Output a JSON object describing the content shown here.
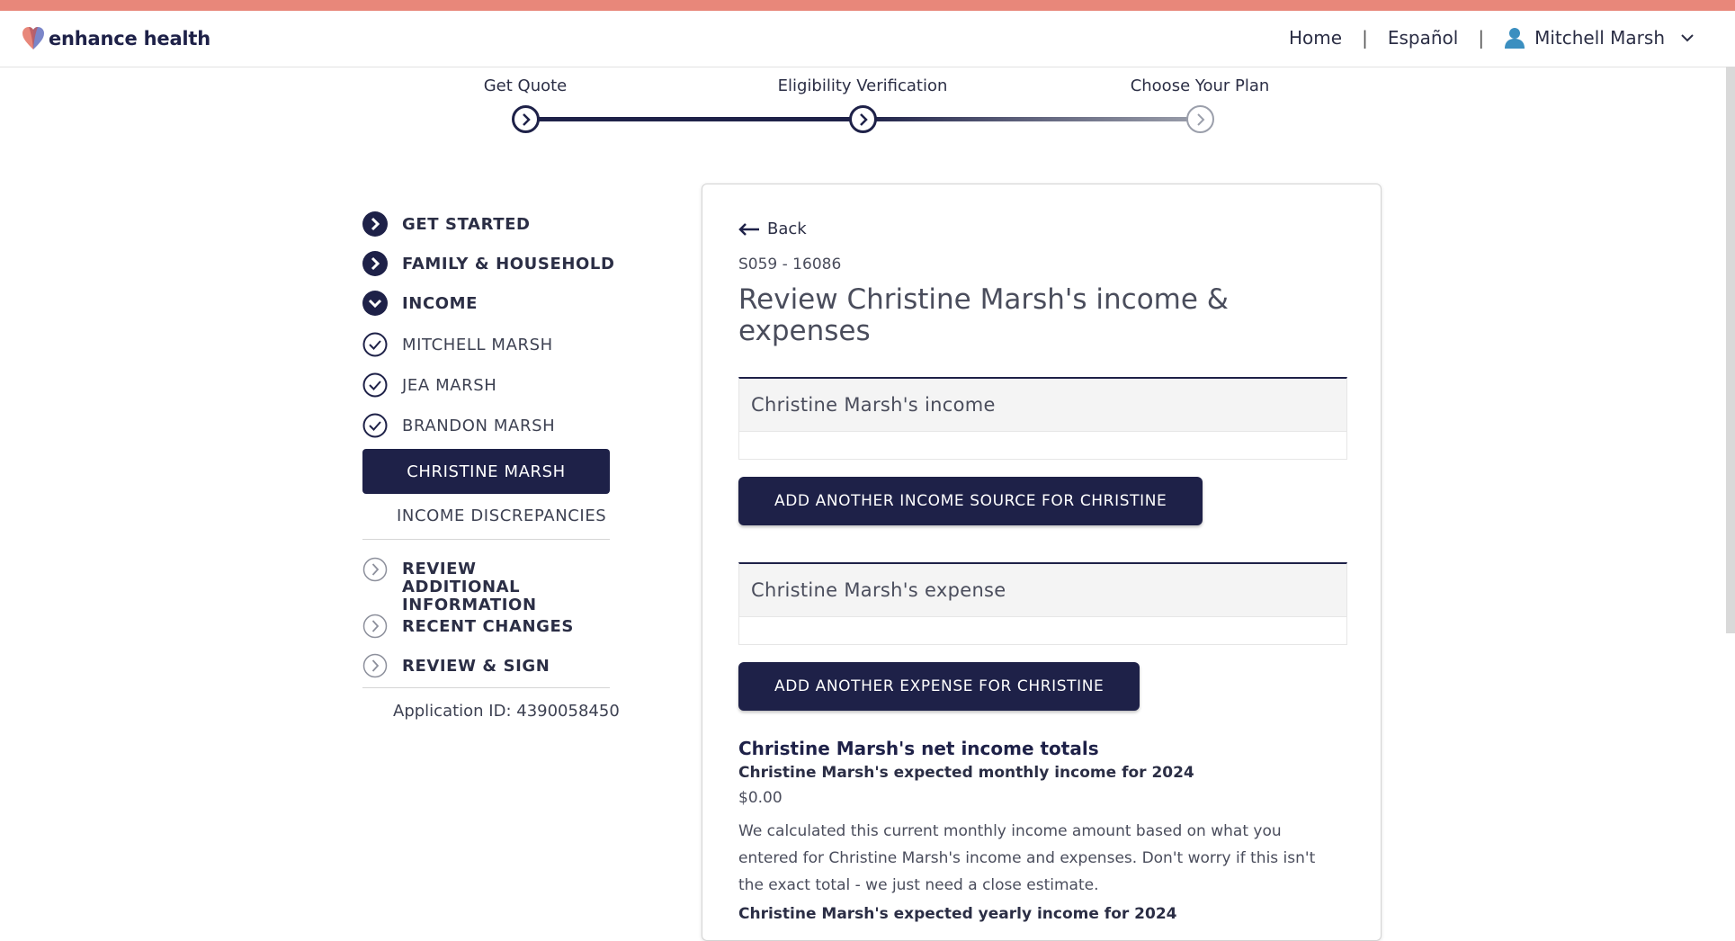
{
  "brand": {
    "name": "enhance health"
  },
  "nav": {
    "home": "Home",
    "sep1": "|",
    "language": "Español",
    "sep2": "|",
    "user_name": "Mitchell Marsh"
  },
  "stepper": {
    "steps": [
      {
        "label": "Get Quote",
        "state": "complete"
      },
      {
        "label": "Eligibility Verification",
        "state": "current"
      },
      {
        "label": "Choose Your Plan",
        "state": "upcoming"
      }
    ]
  },
  "sidebar": {
    "items": [
      {
        "label": "GET STARTED",
        "icon": "chevron-right-circle-filled"
      },
      {
        "label": "FAMILY & HOUSEHOLD",
        "icon": "chevron-right-circle-filled"
      },
      {
        "label": "INCOME",
        "icon": "chevron-down-circle-filled"
      },
      {
        "label": "MITCHELL MARSH",
        "icon": "check-circle-outline"
      },
      {
        "label": "JEA MARSH",
        "icon": "check-circle-outline"
      },
      {
        "label": "BRANDON MARSH",
        "icon": "check-circle-outline"
      },
      {
        "label": "CHRISTINE MARSH",
        "active": true
      },
      {
        "label": "INCOME DISCREPANCIES"
      },
      {
        "label": "REVIEW ADDITIONAL INFORMATION",
        "icon": "chevron-right-circle-outline"
      },
      {
        "label": "RECENT CHANGES",
        "icon": "chevron-right-circle-outline"
      },
      {
        "label": "REVIEW & SIGN",
        "icon": "chevron-right-circle-outline"
      }
    ],
    "application_id": "Application ID: 4390058450"
  },
  "main": {
    "back": "Back",
    "code": "S059 - 16086",
    "title": "Review Christine Marsh's income & expenses",
    "income_section": "Christine Marsh's income",
    "add_income_button": "ADD ANOTHER INCOME SOURCE FOR CHRISTINE",
    "expense_section": "Christine Marsh's expense",
    "add_expense_button": "ADD ANOTHER EXPENSE FOR CHRISTINE",
    "totals_title": "Christine Marsh's net income totals",
    "monthly_label": "Christine Marsh's expected monthly income for 2024",
    "monthly_value": "$0.00",
    "explanation": "We calculated this current monthly income amount based on what you entered for Christine Marsh's income and expenses. Don't worry if this isn't the exact total - we just need a close estimate.",
    "yearly_label": "Christine Marsh's expected yearly income for 2024"
  },
  "colors": {
    "accent_bar": "#e8877a",
    "navy": "#1e2148"
  }
}
